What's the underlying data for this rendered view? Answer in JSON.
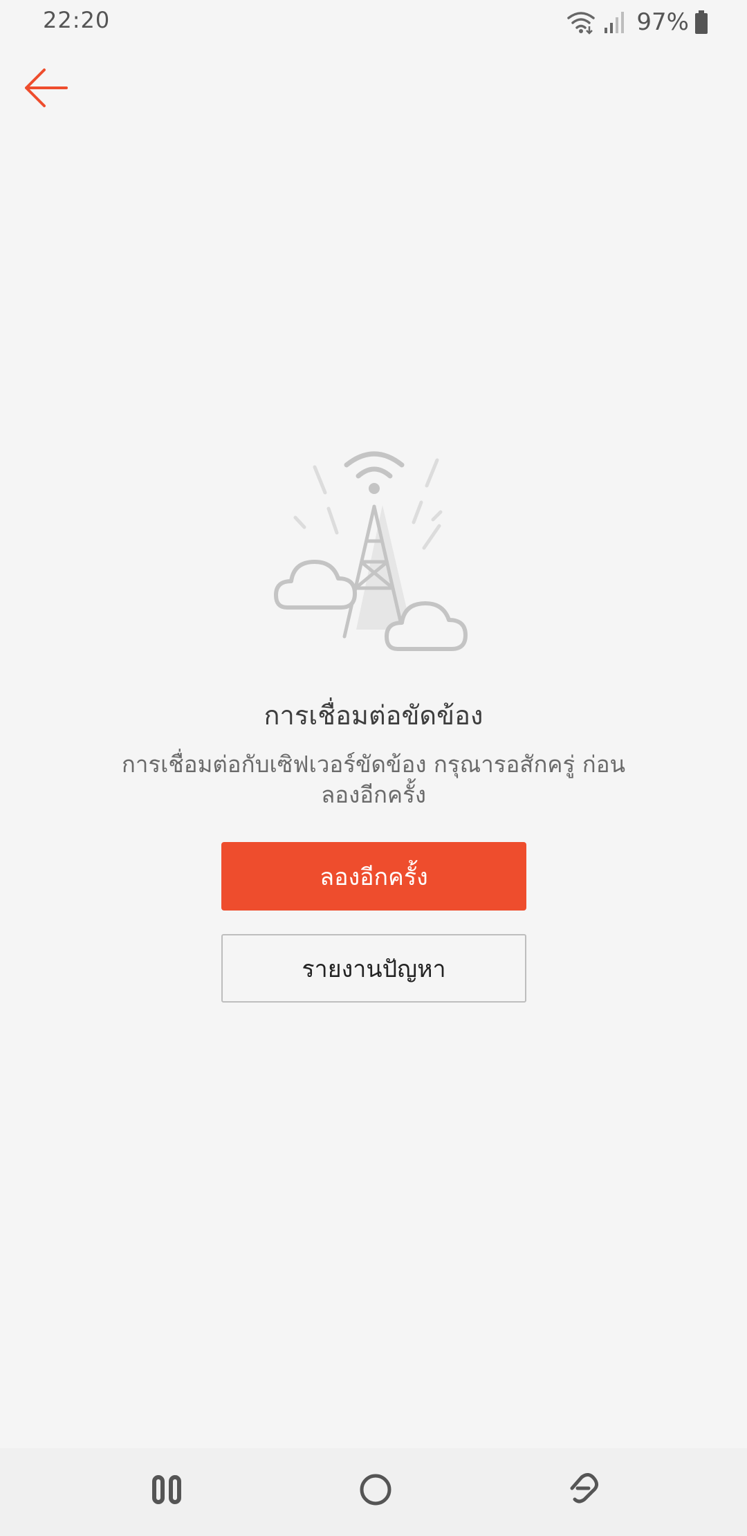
{
  "status_bar": {
    "time": "22:20",
    "battery_text": "97%",
    "icons": [
      "wifi-icon",
      "signal-icon",
      "battery-icon"
    ]
  },
  "header": {
    "back_icon": "back-arrow-icon"
  },
  "error": {
    "illustration": "signal-tower-illustration",
    "title": "การเชื่อมต่อขัดข้อง",
    "message": "การเชื่อมต่อกับเซิฟเวอร์ขัดข้อง กรุณารอสักครู่ ก่อนลองอีกครั้ง"
  },
  "actions": {
    "retry_label": "ลองอีกครั้ง",
    "report_label": "รายงานปัญหา"
  },
  "nav_bar": {
    "icons": [
      "recents-icon",
      "home-icon",
      "back-icon"
    ]
  },
  "colors": {
    "accent": "#ee4d2d",
    "background": "#f5f5f5",
    "title_text": "#3d3d3d",
    "body_text": "#6a6a6a",
    "illustration_stroke": "#c4c4c4"
  }
}
